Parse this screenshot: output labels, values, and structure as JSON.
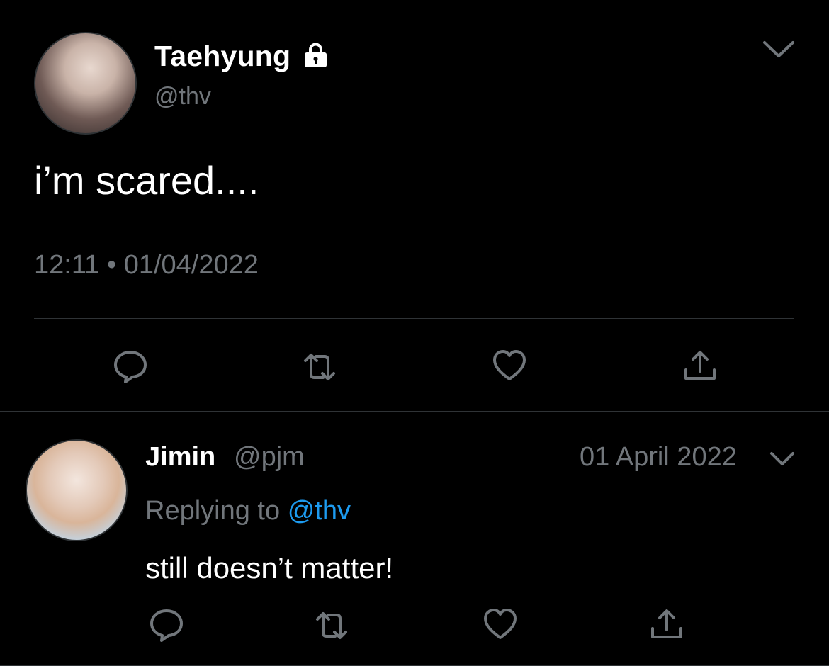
{
  "tweet": {
    "author_name": "Taehyung",
    "author_handle": "@thv",
    "protected_icon": "lock-icon",
    "menu_icon": "chevron-down-icon",
    "text": "i’m scared....",
    "timestamp": "12:11 • 01/04/2022",
    "actions": [
      {
        "icon": "reply-icon"
      },
      {
        "icon": "retweet-icon"
      },
      {
        "icon": "like-icon"
      },
      {
        "icon": "share-icon"
      }
    ]
  },
  "reply": {
    "author_name": "Jimin",
    "author_handle": "@pjm",
    "date": "01 April 2022",
    "menu_icon": "chevron-down-icon",
    "replying_prefix": "Replying to",
    "replying_to": "@thv",
    "text": "still doesn’t matter!",
    "actions": [
      {
        "icon": "reply-icon"
      },
      {
        "icon": "retweet-icon"
      },
      {
        "icon": "like-icon"
      },
      {
        "icon": "share-icon"
      }
    ]
  },
  "colors": {
    "background": "#000000",
    "primary_text": "#ffffff",
    "secondary_text": "#71767b",
    "link": "#1d9bf0",
    "divider": "#2f3336"
  }
}
